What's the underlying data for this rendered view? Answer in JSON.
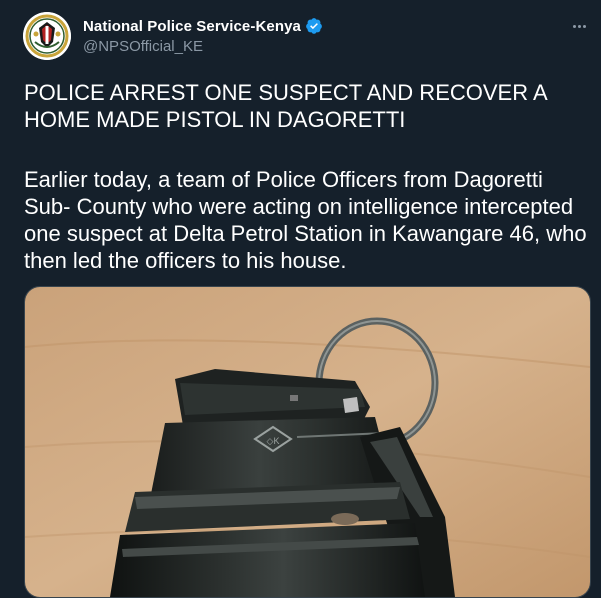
{
  "tweet": {
    "author_name": "National Police Service-Kenya",
    "author_handle": "@NPSOfficial_KE",
    "headline": "POLICE ARREST ONE SUSPECT AND RECOVER A HOME MADE PISTOL IN DAGORETTI",
    "body": "Earlier today, a team of Police Officers from Dagoretti Sub- County who were acting on intelligence intercepted one suspect at Delta Petrol Station in Kawangare 46, who then led the officers to his house.",
    "media_stamp": "◇K"
  },
  "icons": {
    "avatar": "police-crest-icon",
    "verified": "verified-badge-icon",
    "more": "more-options-icon"
  },
  "colors": {
    "background": "#15202b",
    "text_primary": "#ffffff",
    "text_secondary": "#8b98a5",
    "verified_blue": "#1d9bf0"
  }
}
